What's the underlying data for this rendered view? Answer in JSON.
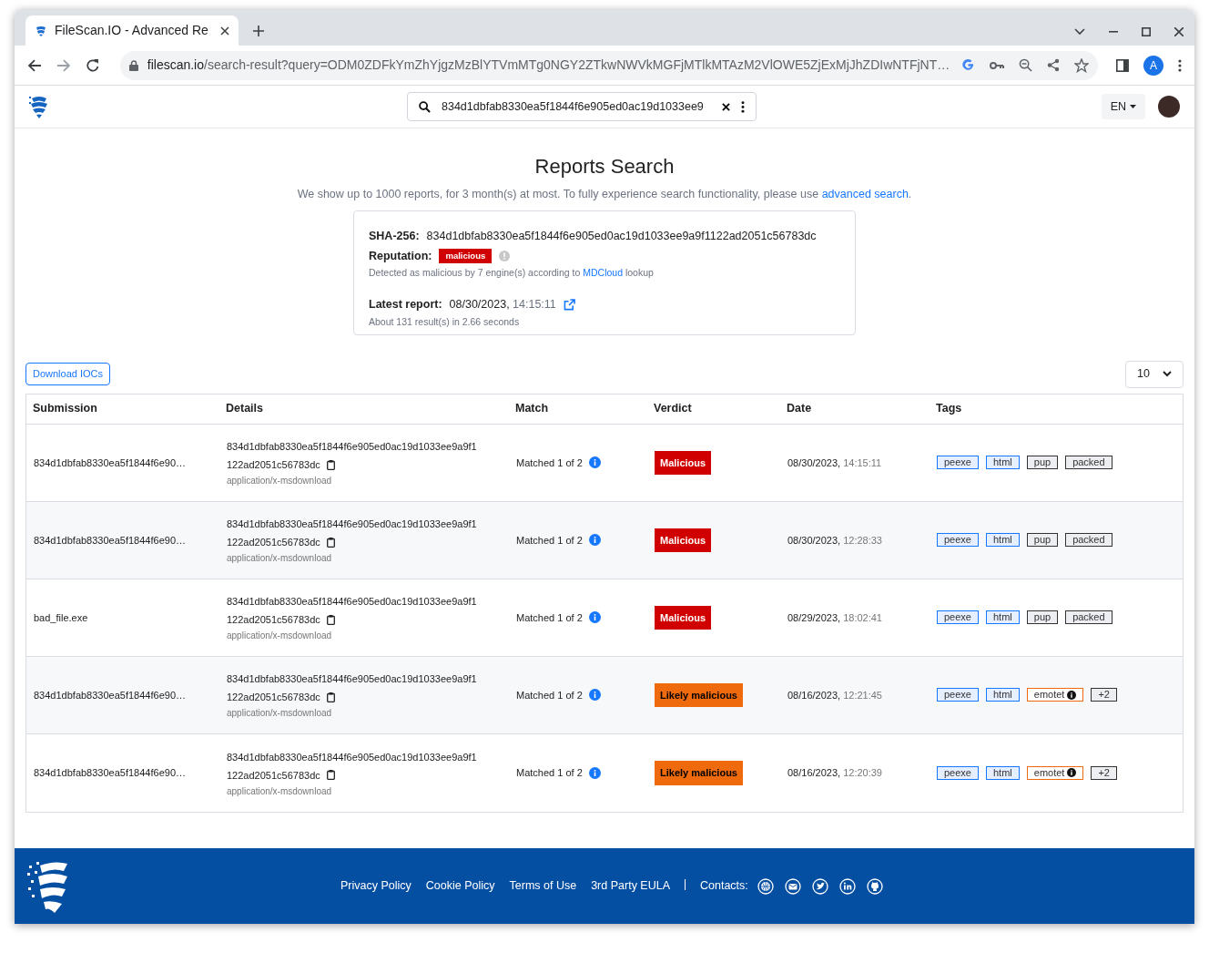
{
  "browser": {
    "tab_title": "FileScan.IO - Advanced Re",
    "url_host": "filescan.io",
    "url_path": "/search-result?query=ODM0ZDFkYmZhYjgzMzBlYTVmMTg0NGY2ZTkwNWVkMGFjMTlkMTAzM2VlOWE5ZjExMjJhZDIwNTFjNT…",
    "profile_initial": "A"
  },
  "header": {
    "search_value": "834d1dbfab8330ea5f1844f6e905ed0ac19d1033ee9",
    "language": "EN"
  },
  "page": {
    "title": "Reports Search",
    "intro": "We show up to 1000 reports, for 3 month(s) at most. To fully experience search functionality, please use",
    "intro_link": "advanced search",
    "intro_end": "."
  },
  "summary": {
    "sha_label": "SHA-256:",
    "sha": "834d1dbfab8330ea5f1844f6e905ed0ac19d1033ee9a9f1122ad2051c56783dc",
    "reputation_label": "Reputation:",
    "reputation": "malicious",
    "detected_text": "Detected as malicious by 7 engine(s) according to",
    "detected_link": "MDCloud",
    "detected_end": "lookup",
    "latest_label": "Latest report:",
    "latest_date": "08/30/2023,",
    "latest_time": "14:15:11",
    "results": "About 131 result(s) in 2.66 seconds"
  },
  "toolbar": {
    "download_button": "Download IOCs",
    "page_size": "10"
  },
  "table": {
    "columns": [
      "Submission",
      "Details",
      "Match",
      "Verdict",
      "Date",
      "Tags"
    ],
    "rows": [
      {
        "submission": "834d1dbfab8330ea5f1844f6e90…",
        "hash_line_1": "834d1dbfab8330ea5f1844f6e905ed0ac19d1033ee9a9f1",
        "hash_line_2": "122ad2051c56783dc",
        "mime": "application/x-msdownload",
        "match": "Matched 1 of 2",
        "verdict": {
          "label": "Malicious",
          "kind": "malicious"
        },
        "date": "08/30/2023,",
        "time": "14:15:11",
        "tags": [
          {
            "label": "peexe",
            "kind": "type"
          },
          {
            "label": "html",
            "kind": "type"
          },
          {
            "label": "pup",
            "kind": "neutral"
          },
          {
            "label": "packed",
            "kind": "neutral"
          }
        ]
      },
      {
        "submission": "834d1dbfab8330ea5f1844f6e90…",
        "hash_line_1": "834d1dbfab8330ea5f1844f6e905ed0ac19d1033ee9a9f1",
        "hash_line_2": "122ad2051c56783dc",
        "mime": "application/x-msdownload",
        "match": "Matched 1 of 2",
        "verdict": {
          "label": "Malicious",
          "kind": "malicious"
        },
        "date": "08/30/2023,",
        "time": "12:28:33",
        "tags": [
          {
            "label": "peexe",
            "kind": "type"
          },
          {
            "label": "html",
            "kind": "type"
          },
          {
            "label": "pup",
            "kind": "neutral"
          },
          {
            "label": "packed",
            "kind": "neutral"
          }
        ]
      },
      {
        "submission": "bad_file.exe",
        "hash_line_1": "834d1dbfab8330ea5f1844f6e905ed0ac19d1033ee9a9f1",
        "hash_line_2": "122ad2051c56783dc",
        "mime": "application/x-msdownload",
        "match": "Matched 1 of 2",
        "verdict": {
          "label": "Malicious",
          "kind": "malicious"
        },
        "date": "08/29/2023,",
        "time": "18:02:41",
        "tags": [
          {
            "label": "peexe",
            "kind": "type"
          },
          {
            "label": "html",
            "kind": "type"
          },
          {
            "label": "pup",
            "kind": "neutral"
          },
          {
            "label": "packed",
            "kind": "neutral"
          }
        ]
      },
      {
        "submission": "834d1dbfab8330ea5f1844f6e90…",
        "hash_line_1": "834d1dbfab8330ea5f1844f6e905ed0ac19d1033ee9a9f1",
        "hash_line_2": "122ad2051c56783dc",
        "mime": "application/x-msdownload",
        "match": "Matched 1 of 2",
        "verdict": {
          "label": "Likely malicious",
          "kind": "likely_malicious"
        },
        "date": "08/16/2023,",
        "time": "12:21:45",
        "tags": [
          {
            "label": "peexe",
            "kind": "type"
          },
          {
            "label": "html",
            "kind": "type"
          },
          {
            "label": "emotet",
            "kind": "threat"
          },
          {
            "label": "+2",
            "kind": "neutral"
          }
        ]
      },
      {
        "submission": "834d1dbfab8330ea5f1844f6e90…",
        "hash_line_1": "834d1dbfab8330ea5f1844f6e905ed0ac19d1033ee9a9f1",
        "hash_line_2": "122ad2051c56783dc",
        "mime": "application/x-msdownload",
        "match": "Matched 1 of 2",
        "verdict": {
          "label": "Likely malicious",
          "kind": "likely_malicious"
        },
        "date": "08/16/2023,",
        "time": "12:20:39",
        "tags": [
          {
            "label": "peexe",
            "kind": "type"
          },
          {
            "label": "html",
            "kind": "type"
          },
          {
            "label": "emotet",
            "kind": "threat"
          },
          {
            "label": "+2",
            "kind": "neutral"
          }
        ]
      }
    ]
  },
  "footer": {
    "links": [
      "Privacy Policy",
      "Cookie Policy",
      "Terms of Use",
      "3rd Party EULA"
    ],
    "contacts_label": "Contacts:"
  }
}
